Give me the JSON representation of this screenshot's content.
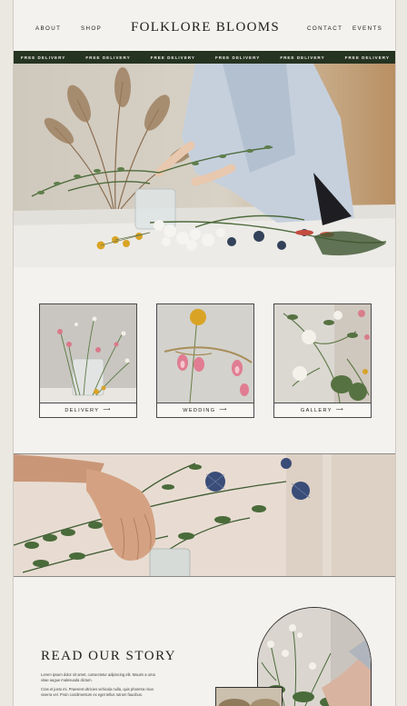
{
  "nav": {
    "left": [
      "ABOUT",
      "SHOP"
    ],
    "right": [
      "CONTACT",
      "EVENTS"
    ]
  },
  "brand": {
    "name": "FOLKLORE BLOOMS"
  },
  "banner": {
    "items": [
      "FREE DELIVERY",
      "FREE DELIVERY",
      "FREE DELIVERY",
      "FREE DELIVERY",
      "FREE DELIVERY",
      "FREE DELIVERY"
    ]
  },
  "cards": [
    {
      "label": "DELIVERY"
    },
    {
      "label": "WEDDING"
    },
    {
      "label": "GALLERY"
    }
  ],
  "story": {
    "title": "READ OUR STORY",
    "para1": "Lorem ipsum dolor sit amet, consectetur adipiscing elit. Mauris a urna vitae augue malesuada dictum.",
    "para2": "Cras et justo mi. Praesent ultricies vehicula nulla, quis pharetra risus viverra vel. Proin condimentum ex eget tellus rutrum faucibus."
  },
  "colors": {
    "banner": "#253321",
    "page": "#f4f2ee",
    "accent_yellow": "#d7a425"
  }
}
